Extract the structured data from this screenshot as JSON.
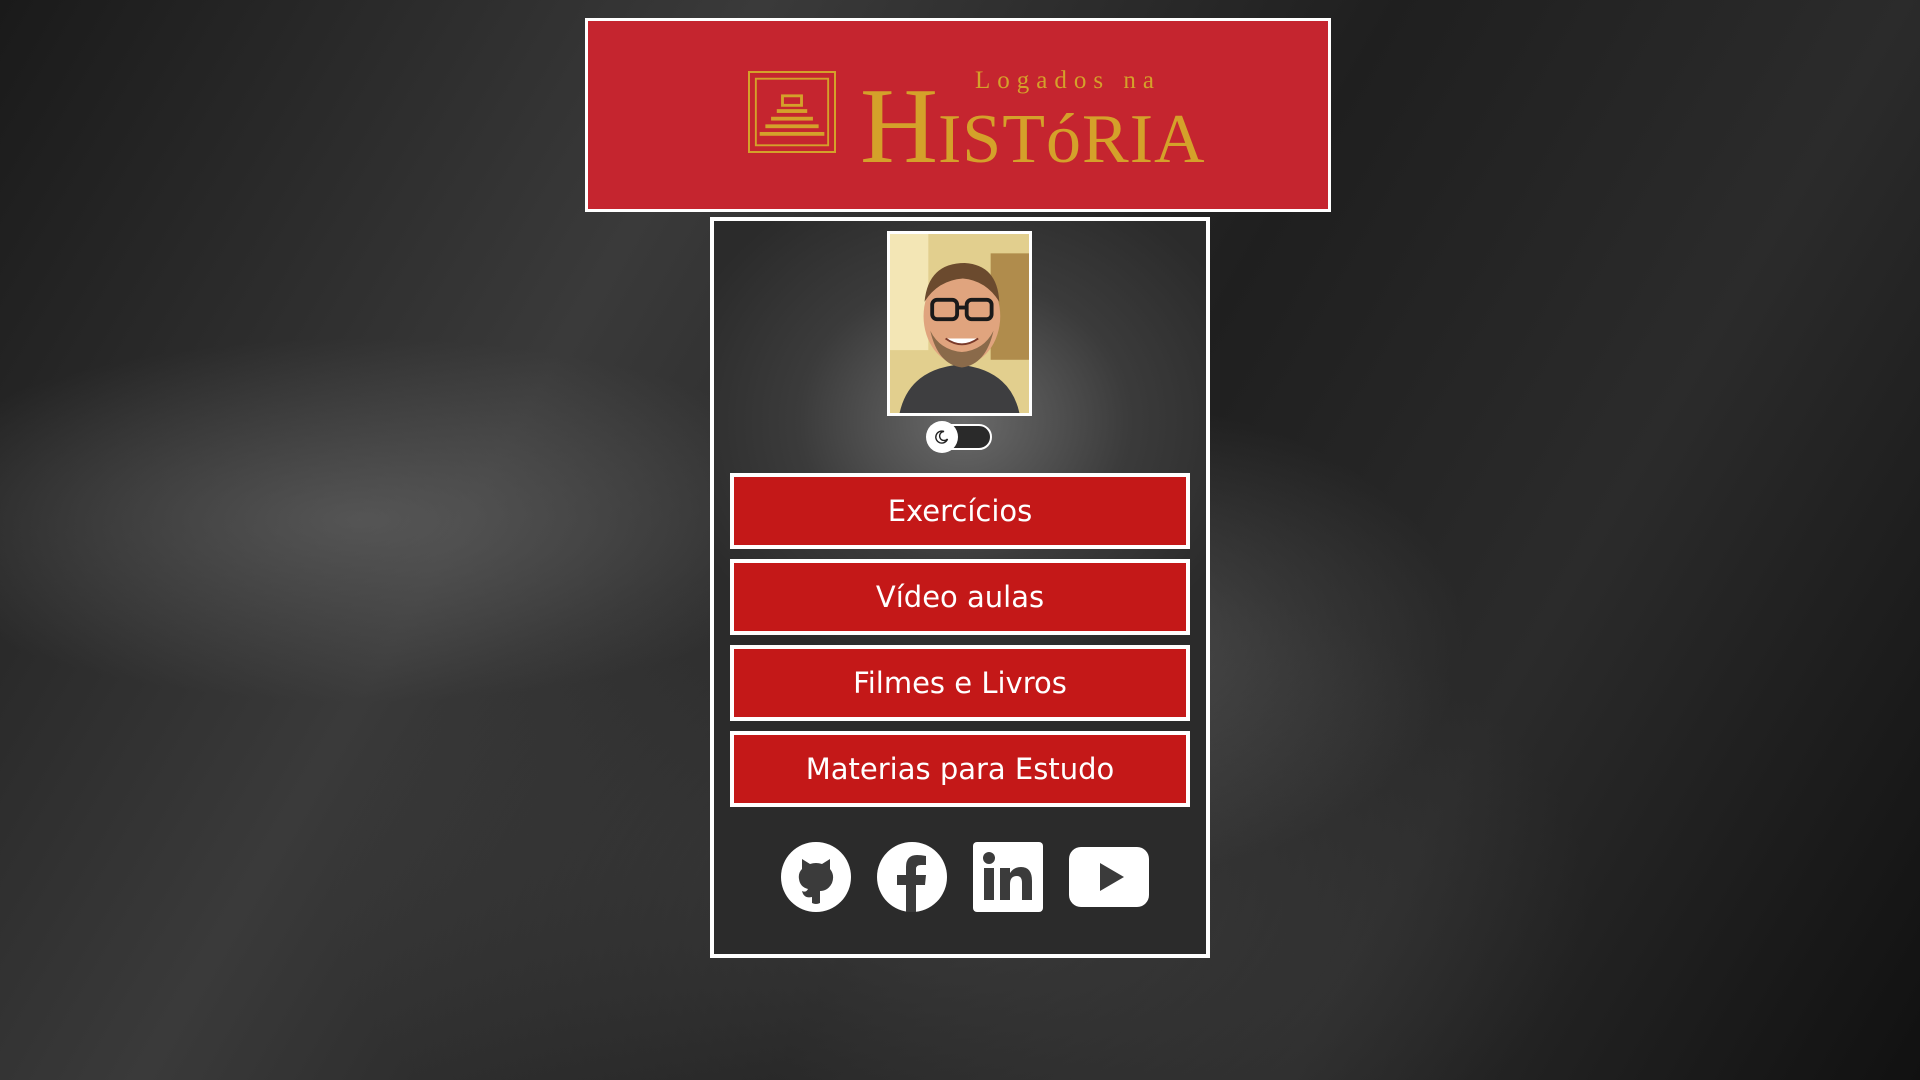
{
  "logo": {
    "small_text": "Logados na",
    "big_cap": "H",
    "big_rest": "ISTóRIA",
    "icon": "pyramid-emblem-icon"
  },
  "profile": {
    "photo": "profile-photo"
  },
  "theme_toggle": {
    "icon": "moon-icon"
  },
  "menu": {
    "items": [
      {
        "label": "Exercícios"
      },
      {
        "label": "Vídeo aulas"
      },
      {
        "label": "Filmes e Livros"
      },
      {
        "label": "Materias para Estudo"
      }
    ]
  },
  "socials": [
    {
      "icon": "github-icon"
    },
    {
      "icon": "facebook-icon"
    },
    {
      "icon": "linkedin-icon"
    },
    {
      "icon": "youtube-icon"
    }
  ],
  "colors": {
    "banner": "#c5252f",
    "logo_gold": "#d4a12a",
    "button": "#c41818",
    "border": "#ffffff"
  }
}
